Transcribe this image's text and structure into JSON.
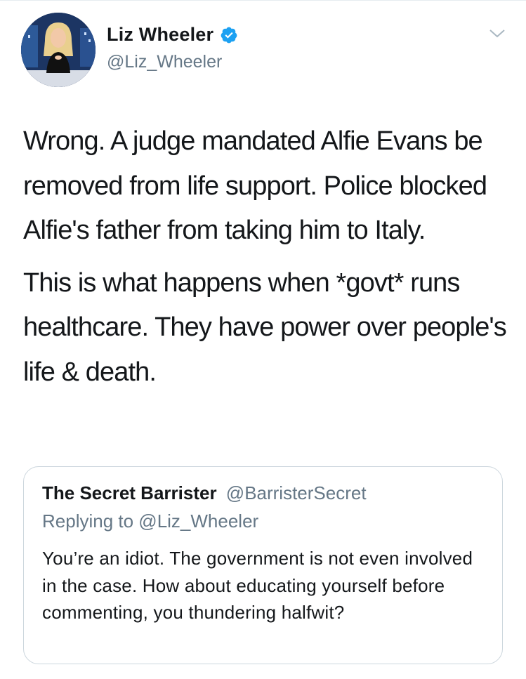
{
  "tweet": {
    "author_name": "Liz Wheeler",
    "author_handle": "@Liz_Wheeler",
    "verified_icon": "verified-badge-icon",
    "menu_icon": "chevron-down-icon",
    "paragraphs": [
      "Wrong. A judge mandated Alfie Evans be removed from life support. Police blocked Alfie's father from taking him to Italy.",
      "This is what happens when *govt* runs healthcare. They have power over people's life & death."
    ]
  },
  "quote": {
    "author_name": "The Secret Barrister",
    "author_handle": "@BarristerSecret",
    "replying_to": "Replying to @Liz_Wheeler",
    "body": "You’re an idiot. The government is not even involved in the case. How about educating yourself before commenting, you thundering halfwit?"
  },
  "colors": {
    "text": "#14171a",
    "secondary": "#657786",
    "verified": "#1da1f2",
    "border": "#ccd6dd"
  }
}
